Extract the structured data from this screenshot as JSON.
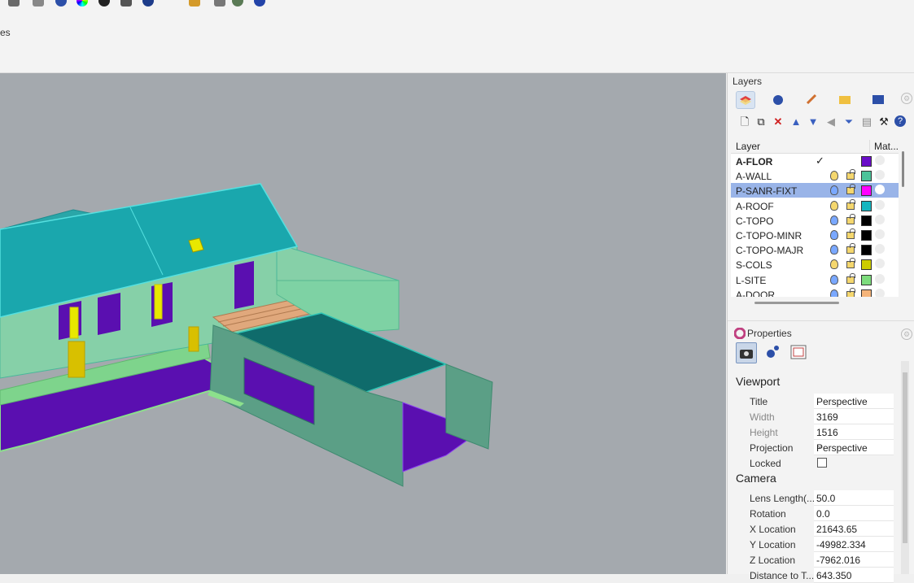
{
  "toolbar": {
    "icons": [
      "render-icon",
      "color-wheel-icon",
      "sphere-icon",
      "camera-icon",
      "globe-icon",
      "paint-icon",
      "grid-icon",
      "earth-icon",
      "help-icon"
    ]
  },
  "command": {
    "text": "es"
  },
  "layers_panel": {
    "title": "Layers",
    "header": {
      "layer": "Layer",
      "material": "Mat..."
    },
    "rows": [
      {
        "name": "A-FLOR",
        "current": true,
        "color": "#6a0dc9"
      },
      {
        "name": "A-WALL",
        "color": "#4cc39a"
      },
      {
        "name": "P-SANR-FIXT",
        "selected": true,
        "color": "#ff00ff"
      },
      {
        "name": "A-ROOF",
        "color": "#16b6c0"
      },
      {
        "name": "C-TOPO",
        "color": "#000000"
      },
      {
        "name": "C-TOPO-MINR",
        "color": "#000000"
      },
      {
        "name": "C-TOPO-MAJR",
        "color": "#000000"
      },
      {
        "name": "S-COLS",
        "color": "#cccc00"
      },
      {
        "name": "L-SITE",
        "color": "#7ddc7d"
      },
      {
        "name": "A-DOOR",
        "color": "#f5b47a"
      }
    ]
  },
  "properties_panel": {
    "title": "Properties",
    "viewport_section": "Viewport",
    "viewport": {
      "title_label": "Title",
      "title_value": "Perspective",
      "width_label": "Width",
      "width_value": "3169",
      "height_label": "Height",
      "height_value": "1516",
      "projection_label": "Projection",
      "projection_value": "Perspective",
      "locked_label": "Locked"
    },
    "camera_section": "Camera",
    "camera": {
      "lens_label": "Lens Length(...",
      "lens_value": "50.0",
      "rotation_label": "Rotation",
      "rotation_value": "0.0",
      "xloc_label": "X Location",
      "xloc_value": "21643.65",
      "yloc_label": "Y Location",
      "yloc_value": "-49982.334",
      "zloc_label": "Z Location",
      "zloc_value": "-7962.016",
      "dist_label": "Distance to T...",
      "dist_value": "643.350"
    }
  }
}
